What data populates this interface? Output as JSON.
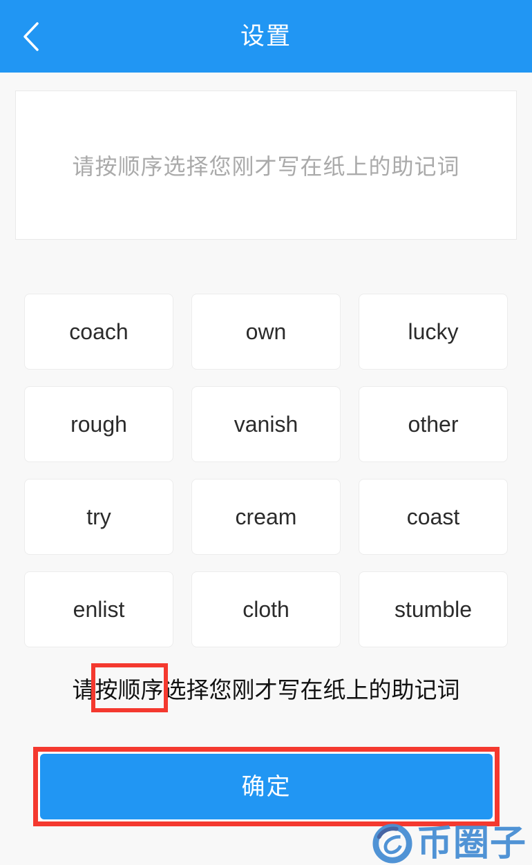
{
  "header": {
    "title": "设置",
    "back_icon": "chevron-left-icon",
    "background_color": "#2196f3",
    "title_color": "#ffffff"
  },
  "mnemonic_display": {
    "value": "",
    "placeholder": "请按顺序选择您刚才写在纸上的助记词",
    "placeholder_color": "#aaaaaa"
  },
  "word_grid": {
    "rows": [
      [
        "coach",
        "own",
        "lucky"
      ],
      [
        "rough",
        "vanish",
        "other"
      ],
      [
        "try",
        "cream",
        "coast"
      ],
      [
        "enlist",
        "cloth",
        "stumble"
      ]
    ],
    "words": [
      "coach",
      "own",
      "lucky",
      "rough",
      "vanish",
      "other",
      "try",
      "cream",
      "coast",
      "enlist",
      "cloth",
      "stumble"
    ]
  },
  "hint": {
    "prefix": "请",
    "highlighted": "按顺序",
    "suffix": "选择您刚才写在纸上的助记词",
    "full_text": "请按顺序选择您刚才写在纸上的助记词",
    "highlight_color": "#f4392f"
  },
  "confirm": {
    "label": "确定",
    "button_color": "#2196f3",
    "annotation_color": "#f4392f"
  },
  "watermark": {
    "text": "币圈子",
    "logo_icon": "circle-swirl-logo-icon",
    "color": "#4a8fd4"
  }
}
